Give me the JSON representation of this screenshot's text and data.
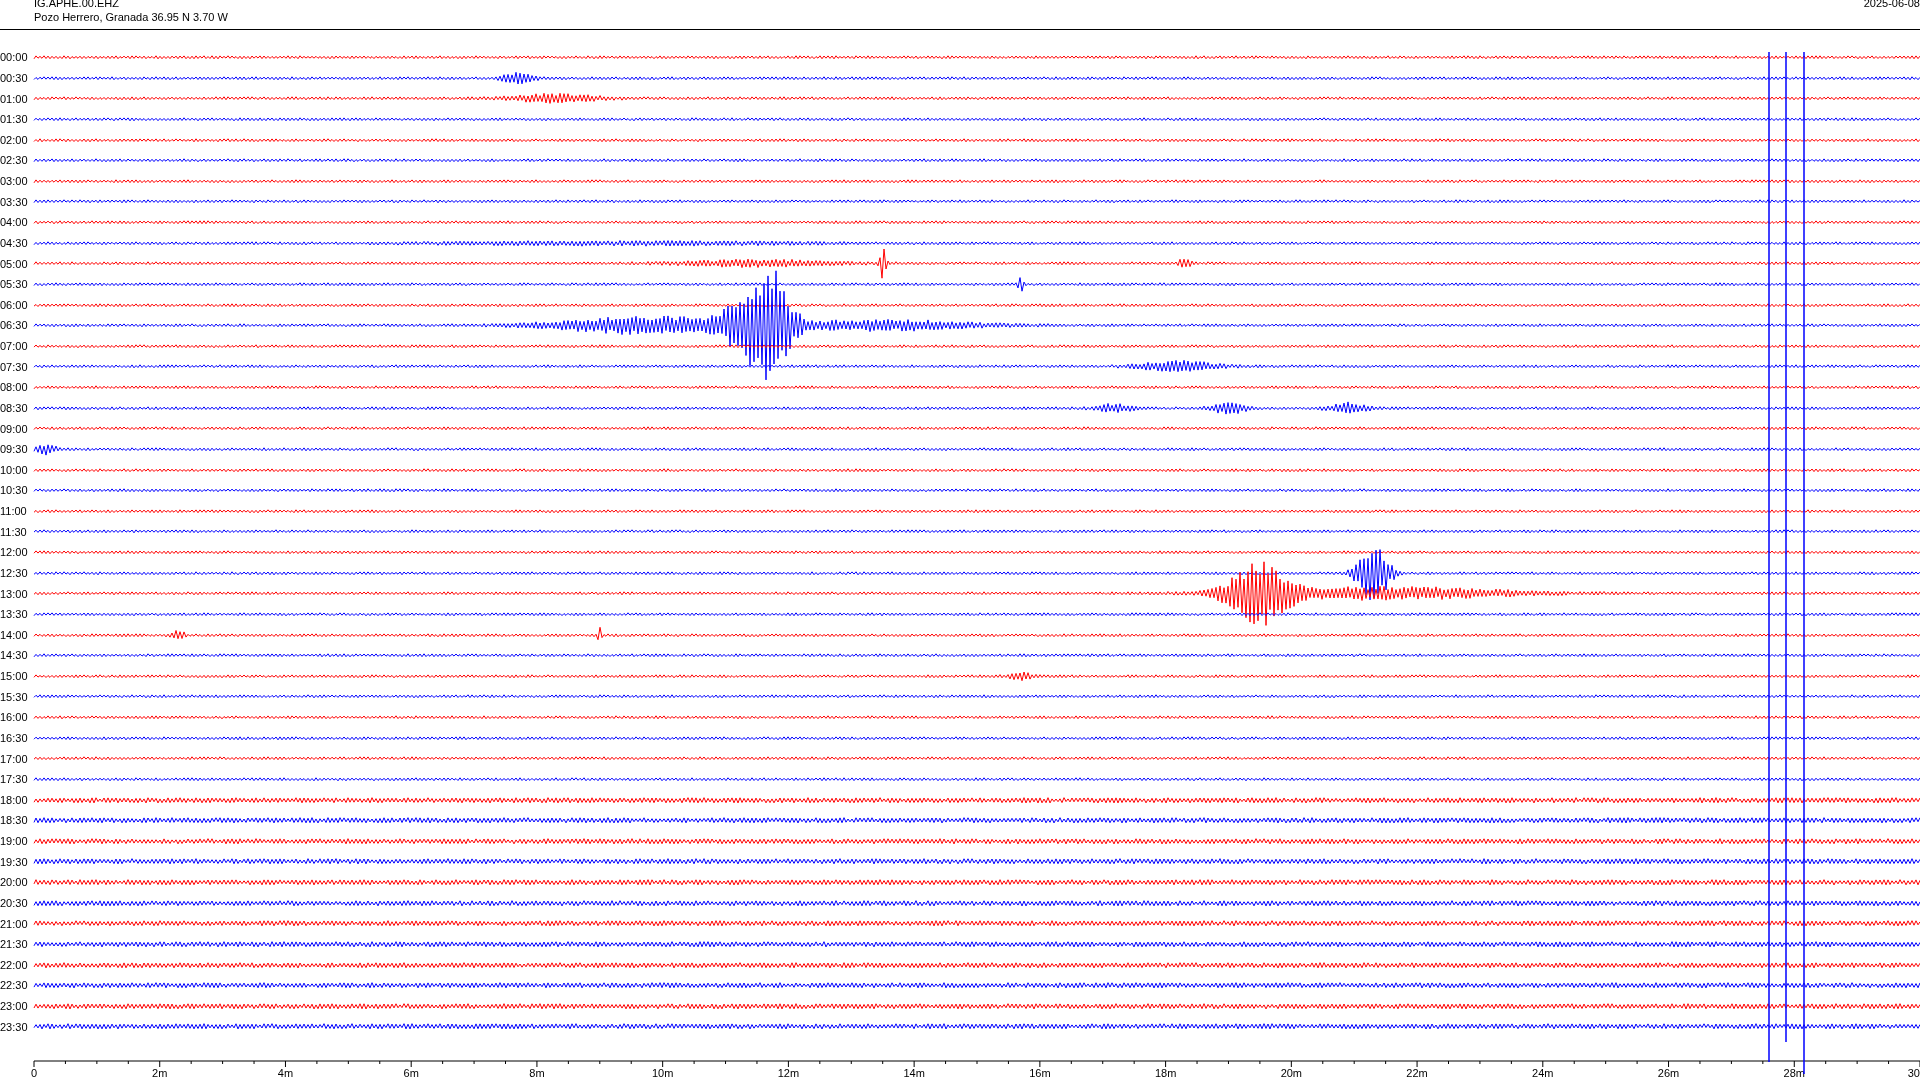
{
  "header": {
    "station": "IG.APHE.00.EHZ",
    "location": "Pozo Herrero, Granada  36.95 N 3.70 W",
    "date": "2025-06-08"
  },
  "rows": [
    {
      "label": "00:00",
      "color": "#ff0000"
    },
    {
      "label": "00:30",
      "color": "#0000ff"
    },
    {
      "label": "01:00",
      "color": "#ff0000"
    },
    {
      "label": "01:30",
      "color": "#0000ff"
    },
    {
      "label": "02:00",
      "color": "#ff0000"
    },
    {
      "label": "02:30",
      "color": "#0000ff"
    },
    {
      "label": "03:00",
      "color": "#ff0000"
    },
    {
      "label": "03:30",
      "color": "#0000ff"
    },
    {
      "label": "04:00",
      "color": "#ff0000"
    },
    {
      "label": "04:30",
      "color": "#0000ff"
    },
    {
      "label": "05:00",
      "color": "#ff0000"
    },
    {
      "label": "05:30",
      "color": "#0000ff"
    },
    {
      "label": "06:00",
      "color": "#ff0000"
    },
    {
      "label": "06:30",
      "color": "#0000ff"
    },
    {
      "label": "07:00",
      "color": "#ff0000"
    },
    {
      "label": "07:30",
      "color": "#0000ff"
    },
    {
      "label": "08:00",
      "color": "#ff0000"
    },
    {
      "label": "08:30",
      "color": "#0000ff"
    },
    {
      "label": "09:00",
      "color": "#ff0000"
    },
    {
      "label": "09:30",
      "color": "#0000ff"
    },
    {
      "label": "10:00",
      "color": "#ff0000"
    },
    {
      "label": "10:30",
      "color": "#0000ff"
    },
    {
      "label": "11:00",
      "color": "#ff0000"
    },
    {
      "label": "11:30",
      "color": "#0000ff"
    },
    {
      "label": "12:00",
      "color": "#ff0000"
    },
    {
      "label": "12:30",
      "color": "#0000ff"
    },
    {
      "label": "13:00",
      "color": "#ff0000"
    },
    {
      "label": "13:30",
      "color": "#0000ff"
    },
    {
      "label": "14:00",
      "color": "#ff0000"
    },
    {
      "label": "14:30",
      "color": "#0000ff"
    },
    {
      "label": "15:00",
      "color": "#ff0000"
    },
    {
      "label": "15:30",
      "color": "#0000ff"
    },
    {
      "label": "16:00",
      "color": "#ff0000"
    },
    {
      "label": "16:30",
      "color": "#0000ff"
    },
    {
      "label": "17:00",
      "color": "#ff0000"
    },
    {
      "label": "17:30",
      "color": "#0000ff"
    },
    {
      "label": "18:00",
      "color": "#ff0000"
    },
    {
      "label": "18:30",
      "color": "#0000ff"
    },
    {
      "label": "19:00",
      "color": "#ff0000"
    },
    {
      "label": "19:30",
      "color": "#0000ff"
    },
    {
      "label": "20:00",
      "color": "#ff0000"
    },
    {
      "label": "20:30",
      "color": "#0000ff"
    },
    {
      "label": "21:00",
      "color": "#ff0000"
    },
    {
      "label": "21:30",
      "color": "#0000ff"
    },
    {
      "label": "22:00",
      "color": "#ff0000"
    },
    {
      "label": "22:30",
      "color": "#0000ff"
    },
    {
      "label": "23:00",
      "color": "#ff0000"
    },
    {
      "label": "23:30",
      "color": "#0000ff"
    }
  ],
  "axis": {
    "labels": [
      "0",
      "2m",
      "4m",
      "6m",
      "8m",
      "10m",
      "12m",
      "14m",
      "16m",
      "18m",
      "20m",
      "22m",
      "24m",
      "26m",
      "28m",
      "30"
    ]
  }
}
